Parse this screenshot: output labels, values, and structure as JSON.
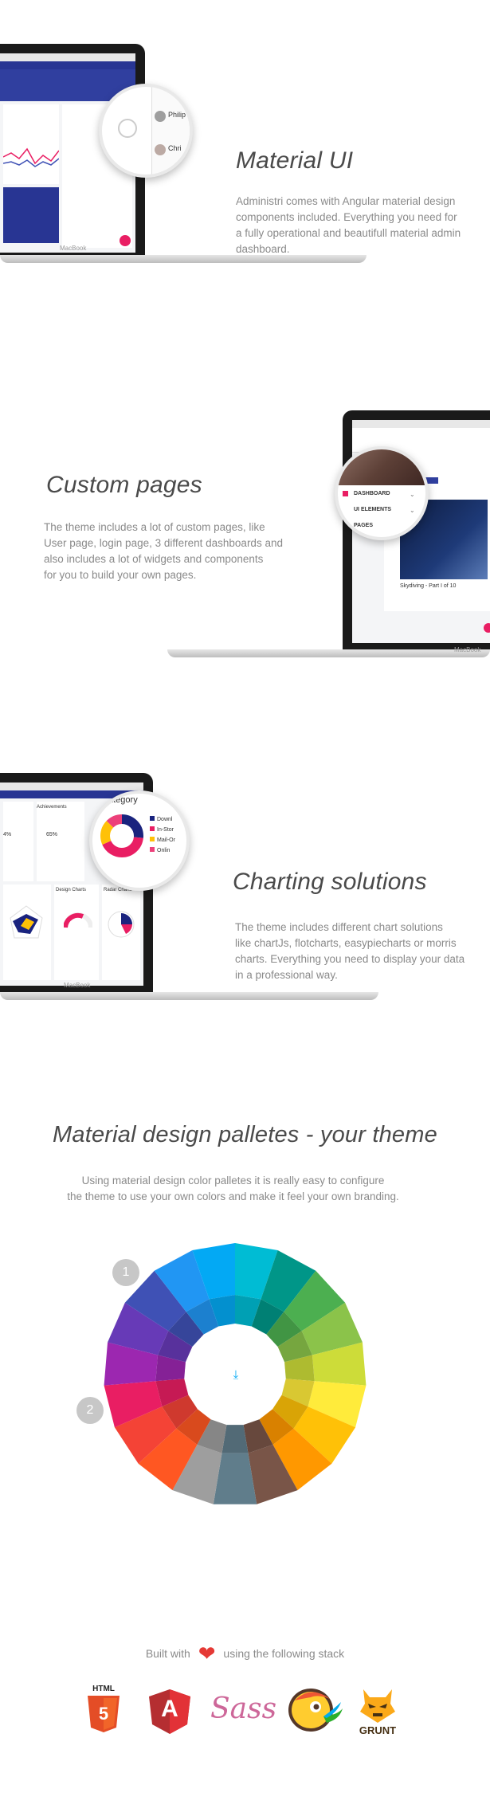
{
  "features": [
    {
      "title": "Material UI",
      "text_lines": [
        "Administri comes with Angular material design",
        "components included. Everything you need for",
        "a fully operational and beautifull material admin",
        "dashboard."
      ],
      "laptop_brand": "MacBook",
      "zoom_labels": [
        "Philip",
        "Chri"
      ]
    },
    {
      "title": "Custom pages",
      "text_lines": [
        "The theme includes a lot of custom pages, like",
        "User page, login page, 3 different dashboards and",
        "also includes a lot of widgets and components",
        "for you to build your own pages."
      ],
      "laptop_brand": "MacBook",
      "zoom_labels": [
        "DASHBOARD",
        "UI ELEMENTS",
        "PAGES"
      ],
      "screen_caption": "Skydiving - Part I of 10"
    },
    {
      "title": "Charting solutions",
      "text_lines": [
        "The theme includes different chart solutions",
        "like chartJs, flotcharts, easypiecharts or morris",
        "charts. Everything you need to display your data",
        "in a professional way."
      ],
      "laptop_brand": "MacBook",
      "zoom_title": "ategory",
      "zoom_legend": [
        "Downl",
        "In-Stor",
        "Mail-Or",
        "Onlin"
      ],
      "screen_labels": [
        "Achievements",
        "65%",
        "4%",
        "Design Charts",
        "Radar Charts"
      ]
    }
  ],
  "palette": {
    "title": "Material design palletes - your theme",
    "text_lines": [
      "Using material design color palletes it is really easy to configure",
      "the theme to use your own colors and make it feel your own branding."
    ],
    "markers": [
      "1",
      "2"
    ],
    "colors": [
      "#00bcd4",
      "#009688",
      "#4caf50",
      "#8bc34a",
      "#cddc39",
      "#ffeb3b",
      "#ffc107",
      "#ff9800",
      "#795548",
      "#607d8b",
      "#9e9e9e",
      "#ff5722",
      "#f44336",
      "#e91e63",
      "#9c27b0",
      "#673ab7",
      "#3f51b5",
      "#2196f3",
      "#03a9f4"
    ],
    "center_icon": "download-icon"
  },
  "footer": {
    "built_prefix": "Built with",
    "built_suffix": "using the following stack",
    "heart_icon": "heart-icon",
    "logos": [
      {
        "name": "html5-logo",
        "label": "HTML",
        "sub": "5"
      },
      {
        "name": "angular-logo",
        "label": "A"
      },
      {
        "name": "sass-logo",
        "label": "Sass"
      },
      {
        "name": "bower-logo",
        "label": ""
      },
      {
        "name": "grunt-logo",
        "label": "GRUNT"
      }
    ]
  }
}
